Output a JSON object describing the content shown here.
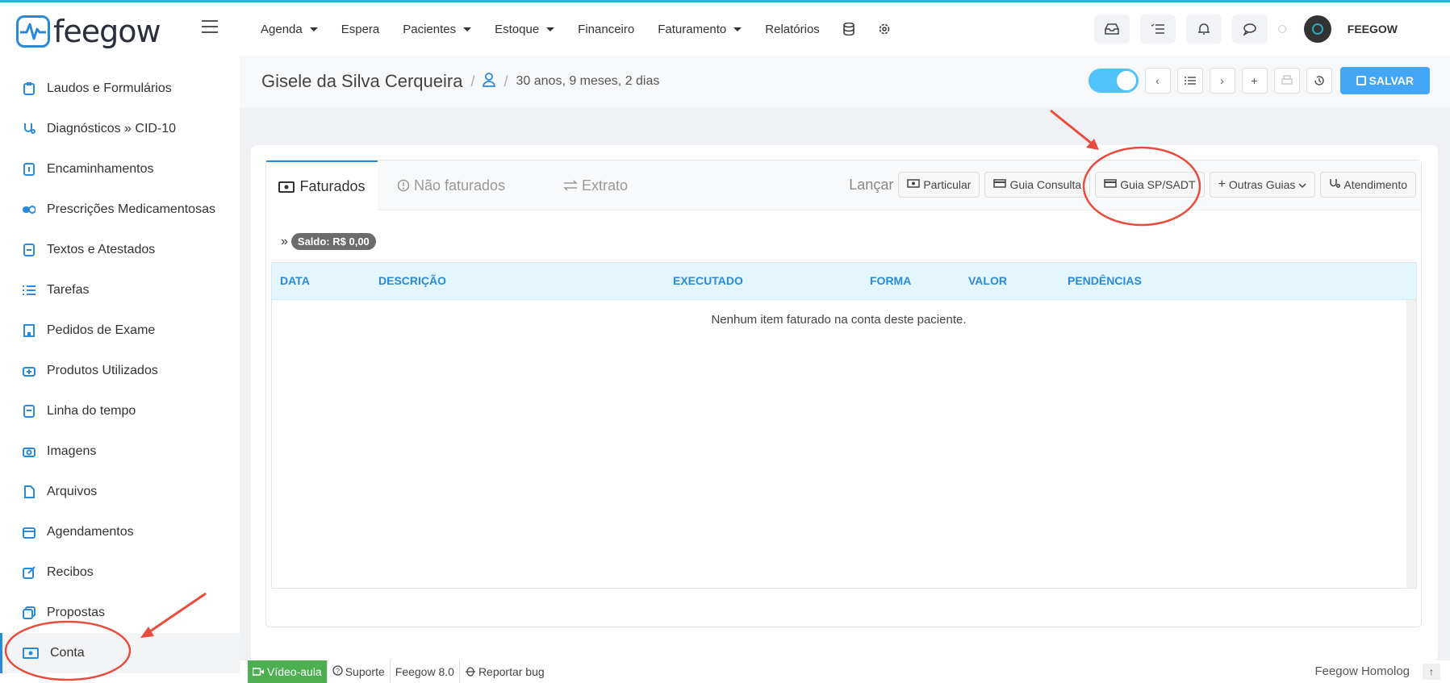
{
  "brand": {
    "name": "feegow"
  },
  "sidebar": {
    "items": [
      {
        "label": "Laudos e Formulários",
        "icon": "clipboard-icon"
      },
      {
        "label": "Diagnósticos » CID-10",
        "icon": "stethoscope-icon"
      },
      {
        "label": "Encaminhamentos",
        "icon": "document-icon"
      },
      {
        "label": "Prescrições Medicamentosas",
        "icon": "pills-icon"
      },
      {
        "label": "Textos e Atestados",
        "icon": "file-text-icon"
      },
      {
        "label": "Tarefas",
        "icon": "tasks-icon"
      },
      {
        "label": "Pedidos de Exame",
        "icon": "building-icon"
      },
      {
        "label": "Produtos Utilizados",
        "icon": "medkit-icon"
      },
      {
        "label": "Linha do tempo",
        "icon": "timeline-icon"
      },
      {
        "label": "Imagens",
        "icon": "camera-icon"
      },
      {
        "label": "Arquivos",
        "icon": "file-icon"
      },
      {
        "label": "Agendamentos",
        "icon": "calendar-icon"
      },
      {
        "label": "Recibos",
        "icon": "edit-icon"
      },
      {
        "label": "Propostas",
        "icon": "copy-icon"
      },
      {
        "label": "Conta",
        "icon": "money-icon"
      }
    ]
  },
  "topnav": {
    "items": [
      "Agenda",
      "Espera",
      "Pacientes",
      "Estoque",
      "Financeiro",
      "Faturamento",
      "Relatórios"
    ],
    "user": "FEEGOW"
  },
  "patient": {
    "name": "Gisele da Silva Cerqueira",
    "age": "30 anos, 9 meses, 2 dias",
    "save_label": "SALVAR"
  },
  "tabs": [
    "Faturados",
    "Não faturados",
    "Extrato"
  ],
  "launch": {
    "label": "Lançar",
    "buttons": [
      "Particular",
      "Guia Consulta",
      "Guia SP/SADT",
      "Outras Guias",
      "Atendimento"
    ]
  },
  "saldo": "Saldo: R$ 0,00",
  "table": {
    "columns": [
      "DATA",
      "DESCRIÇÃO",
      "EXECUTADO",
      "FORMA",
      "VALOR",
      "PENDÊNCIAS"
    ],
    "empty": "Nenhum item faturado na conta deste paciente."
  },
  "footer": {
    "video": "Vídeo-aula",
    "support": "Suporte",
    "version": "Feegow 8.0",
    "bug": "Reportar bug",
    "env": "Feegow Homolog"
  },
  "colors": {
    "accent": "#2b8ad8",
    "save": "#42a5f5",
    "annotation": "#e74c3c",
    "video": "#4caf50"
  }
}
